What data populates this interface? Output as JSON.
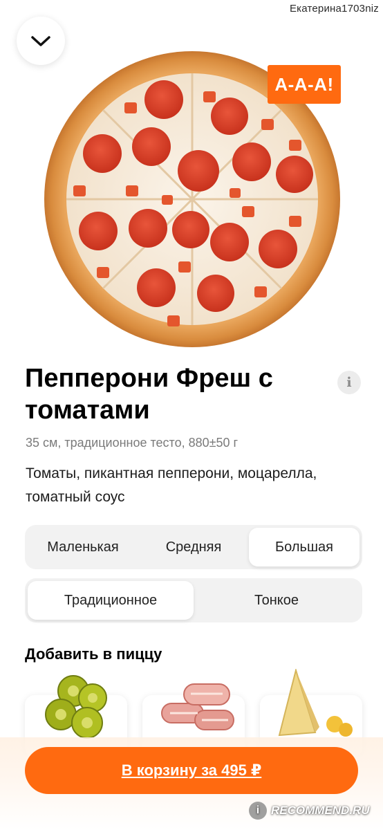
{
  "watermark_user": "Екатерина1703niz",
  "promo_badge": "А-А-А!",
  "product": {
    "title": "Пепперони Фреш с томатами",
    "meta": "35 см, традиционное тесто, 880±50 г",
    "description": "Томаты, пикантная пепперони, моцарелла, томатный соус"
  },
  "size_options": [
    "Маленькая",
    "Средняя",
    "Большая"
  ],
  "size_selected": "Большая",
  "dough_options": [
    "Традиционное",
    "Тонкое"
  ],
  "dough_selected": "Традиционное",
  "toppings_section": {
    "title": "Добавить в пиццу"
  },
  "cart_button": {
    "label": "В корзину за 495 ₽"
  },
  "watermark_site": "RECOMMEND.RU",
  "colors": {
    "accent": "#ff6a10",
    "segment_bg": "#f2f2f2"
  },
  "icons": {
    "close": "chevron-down-icon",
    "info": "info-icon"
  }
}
